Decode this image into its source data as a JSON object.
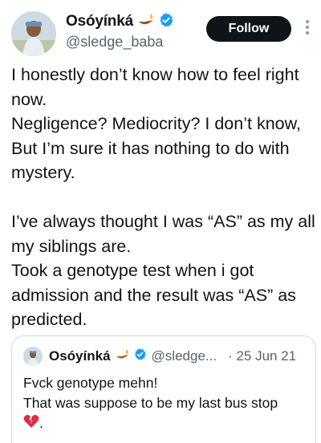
{
  "author": {
    "display_name": "Osóyínká",
    "handle": "@sledge_baba",
    "verified": true,
    "avatar": "avatar-photo"
  },
  "actions": {
    "follow_label": "Follow",
    "more_icon": "more-vertical-icon"
  },
  "tweet": {
    "lines": [
      "I honestly don’t know how to feel right now.",
      "Negligence? Mediocrity? I don’t know, But I’m sure it has nothing to do with mystery.",
      "I’ve always thought I was “AS” as my all my siblings are.",
      "Took a genotype test when i got admission and the result was “AS” as predicted."
    ]
  },
  "quote": {
    "display_name": "Osóyínká",
    "handle": "@sledge...",
    "date": "· 25 Jun 21",
    "lines": [
      "Fvck genotype mehn!",
      "That was suppose to be my last bus stop"
    ],
    "trailing_text": ".",
    "emoji": "broken-heart-icon"
  },
  "colors": {
    "follow_bg": "#0f1419",
    "verified_blue": "#1d9bf0",
    "secondary_text": "#536471",
    "border": "#cfd9de"
  }
}
